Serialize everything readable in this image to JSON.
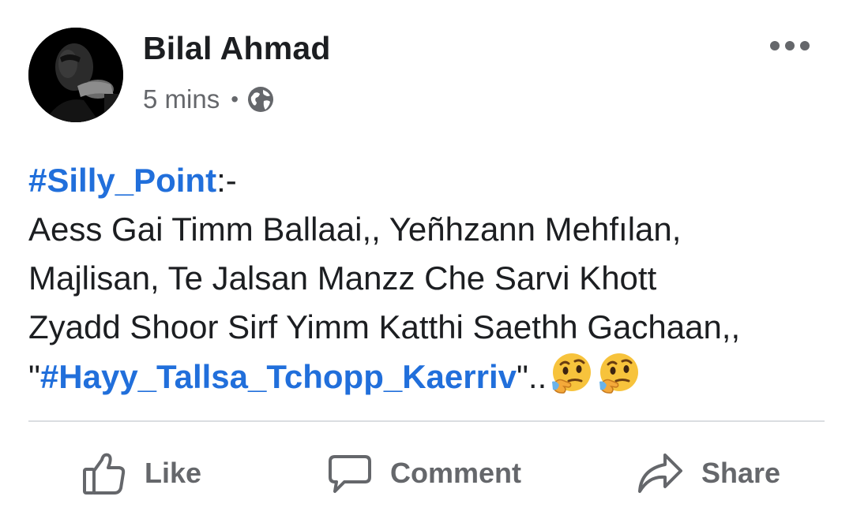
{
  "post": {
    "author": "Bilal Ahmad",
    "time": "5 mins",
    "separator": "•",
    "privacy_icon": "globe-icon",
    "more_icon": "more-options-icon",
    "body": {
      "hashtag_1": "#Silly_Point",
      "after_hashtag_1": ":-",
      "line_2": "Aess Gai Timm Ballaai,, Yeñhzann Mehfılan,",
      "line_3": "Majlisan, Te Jalsan Manzz Che Sarvi Khott",
      "line_4": "Zyadd Shoor Sirf Yimm Katthi Saethh Gachaan,,",
      "quote_open": "\"",
      "hashtag_2": "#Hayy_Tallsa_Tchopp_Kaerriv",
      "quote_close": "\"..",
      "emojis": [
        "thinking-face-emoji",
        "thinking-face-emoji"
      ]
    }
  },
  "actions": {
    "like_label": "Like",
    "comment_label": "Comment",
    "share_label": "Share"
  },
  "colors": {
    "hashtag": "#216fdb",
    "secondary_text": "#65676b",
    "primary_text": "#1c1e21",
    "divider": "#dadde1"
  }
}
